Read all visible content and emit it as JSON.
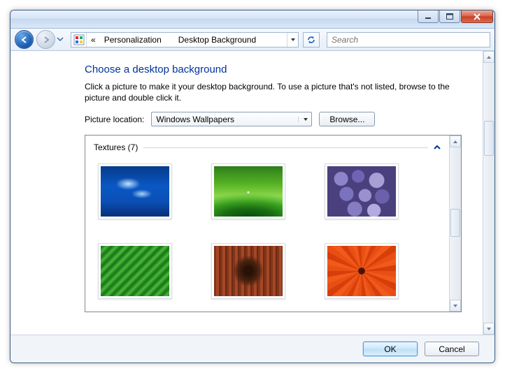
{
  "breadcrumb": {
    "root_chevron": "«",
    "items": [
      {
        "label": "Personalization"
      },
      {
        "label": "Desktop Background"
      }
    ]
  },
  "search": {
    "placeholder": "Search"
  },
  "main": {
    "title": "Choose a desktop background",
    "description": "Click a picture to make it your desktop background. To use a picture that's not listed, browse to the picture and double click it.",
    "location_label": "Picture location:",
    "location_value": "Windows Wallpapers",
    "browse_label": "Browse...",
    "group_label": "Textures (7)"
  },
  "buttons": {
    "ok": "OK",
    "cancel": "Cancel"
  }
}
